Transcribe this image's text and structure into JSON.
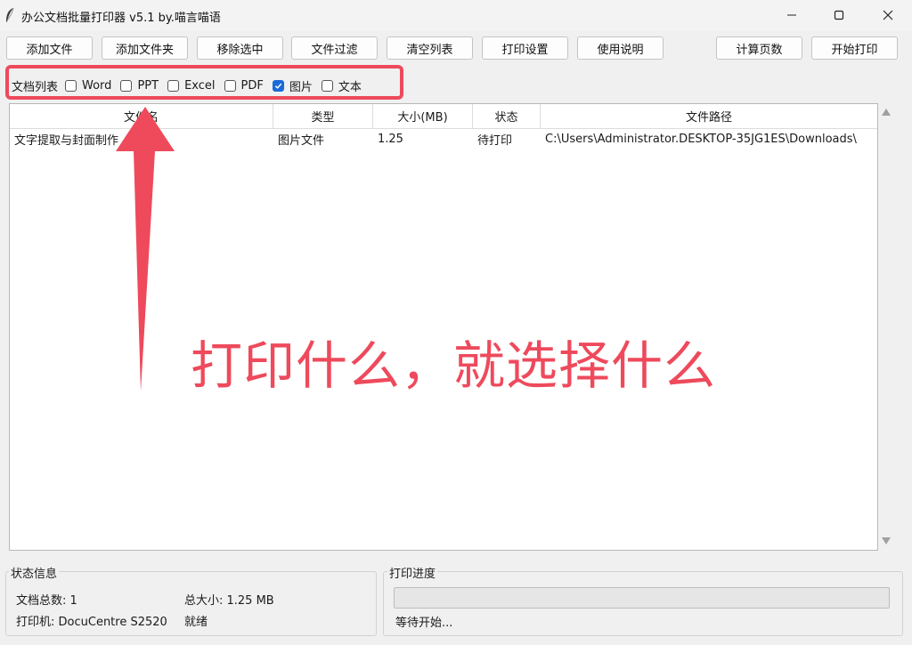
{
  "window": {
    "title": "办公文档批量打印器 v5.1 by.喵言喵语"
  },
  "toolbar": {
    "add_file": "添加文件",
    "add_folder": "添加文件夹",
    "remove_selected": "移除选中",
    "file_filter": "文件过滤",
    "clear_list": "清空列表",
    "print_settings": "打印设置",
    "usage_help": "使用说明",
    "count_pages": "计算页数",
    "start_print": "开始打印"
  },
  "filter": {
    "label": "文档列表",
    "options": [
      {
        "label": "Word",
        "checked": false
      },
      {
        "label": "PPT",
        "checked": false
      },
      {
        "label": "Excel",
        "checked": false
      },
      {
        "label": "PDF",
        "checked": false
      },
      {
        "label": "图片",
        "checked": true
      },
      {
        "label": "文本",
        "checked": false
      }
    ]
  },
  "table": {
    "columns": [
      "文件名",
      "类型",
      "大小(MB)",
      "状态",
      "文件路径"
    ],
    "rows": [
      {
        "name": "文字提取与封面制作",
        "type": "图片文件",
        "size": "1.25",
        "status": "待打印",
        "path": "C:\\Users\\Administrator.DESKTOP-35JG1ES\\Downloads\\"
      }
    ]
  },
  "annotation": {
    "text": "打印什么，就选择什么",
    "color": "#ee4a5c"
  },
  "status_panel": {
    "title": "状态信息",
    "doc_count": "文档总数: 1",
    "total_size": "总大小: 1.25 MB",
    "printer": "打印机: DocuCentre S2520",
    "state": "就绪"
  },
  "progress_panel": {
    "title": "打印进度",
    "progress": 0,
    "status_text": "等待开始..."
  }
}
